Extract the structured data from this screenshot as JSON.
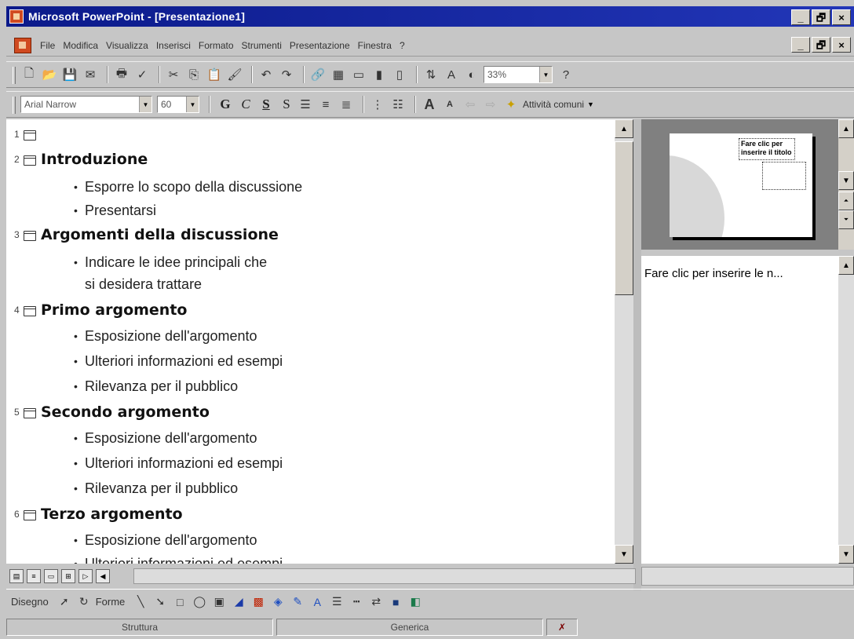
{
  "window": {
    "title": "Microsoft PowerPoint - [Presentazione1]",
    "buttons": [
      "_",
      "🗗",
      "×"
    ]
  },
  "menubar": {
    "items": [
      "File",
      "Modifica",
      "Visualizza",
      "Inserisci",
      "Formato",
      "Strumenti",
      "Presentazione",
      "Finestra",
      "?"
    ]
  },
  "toolbar_standard": {
    "zoom": "33%"
  },
  "toolbar_format": {
    "font": "Arial Narrow",
    "size": "60",
    "bold": "G",
    "italic": "C",
    "underline": "S",
    "shadow": "S",
    "tasks": "Attività comuni"
  },
  "outline": {
    "slides": [
      {
        "num": "1",
        "title": "",
        "bullets": []
      },
      {
        "num": "2",
        "title": "Introduzione",
        "bullets": [
          "Esporre lo scopo della discussione",
          "Presentarsi"
        ]
      },
      {
        "num": "3",
        "title": "Argomenti della discussione",
        "bullets": [
          "Indicare le idee principali che",
          "si desidera trattare"
        ]
      },
      {
        "num": "4",
        "title": "Primo argomento",
        "bullets": [
          "Esposizione dell'argomento",
          "Ulteriori informazioni ed esempi",
          "Rilevanza per il pubblico"
        ]
      },
      {
        "num": "5",
        "title": "Secondo argomento",
        "bullets": [
          "Esposizione dell'argomento",
          "Ulteriori informazioni ed esempi",
          "Rilevanza per il pubblico"
        ]
      },
      {
        "num": "6",
        "title": "Terzo argomento",
        "bullets": [
          "Esposizione dell'argomento",
          "Ulteriori informazioni ed esempi"
        ]
      }
    ]
  },
  "preview": {
    "title_placeholder": "Fare clic per inserire il titolo"
  },
  "notes": {
    "text": "Fare clic per inserire le n..."
  },
  "drawbar": {
    "draw": "Disegno",
    "shapes": "Forme"
  },
  "status": {
    "view": "Struttura",
    "design": "Generica"
  }
}
